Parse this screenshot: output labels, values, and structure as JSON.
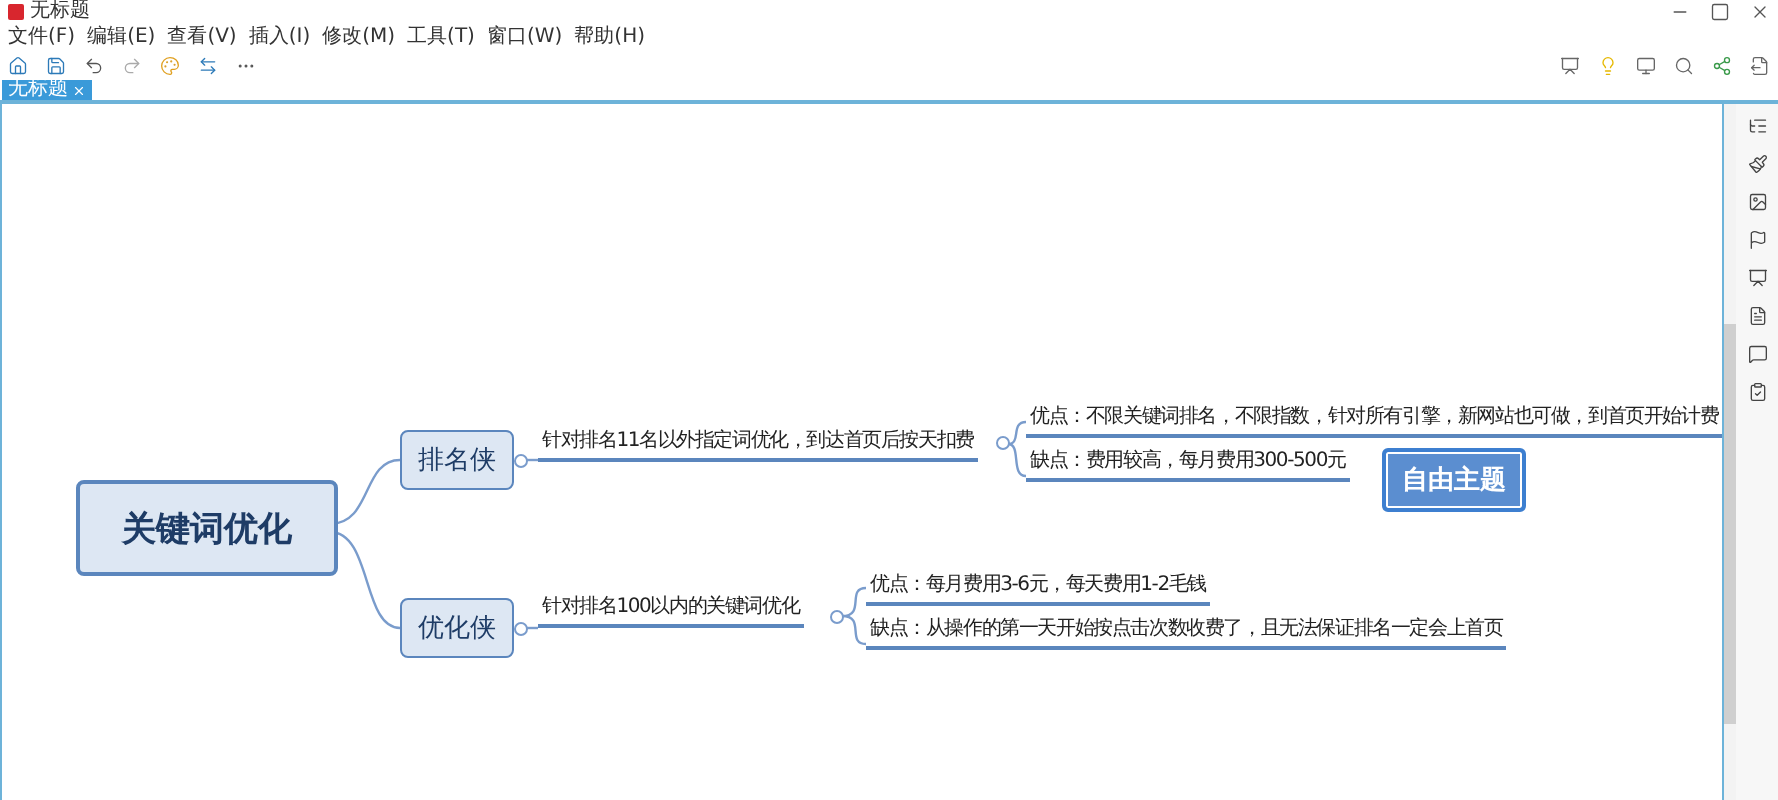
{
  "window": {
    "title": "无标题"
  },
  "menu": [
    "文件(F)",
    "编辑(E)",
    "查看(V)",
    "插入(I)",
    "修改(M)",
    "工具(T)",
    "窗口(W)",
    "帮助(H)"
  ],
  "tabs": [
    {
      "label": "无标题",
      "selected": true
    }
  ],
  "map": {
    "central": {
      "text": "关键词优化",
      "children": [
        {
          "text": "排名侠",
          "children": [
            {
              "text": "针对排名11名以外指定词优化，到达首页后按天扣费",
              "children": [
                {
                  "text": "优点：不限关键词排名，不限指数，针对所有引擎，新网站也可做，到首页开始计费"
                },
                {
                  "text": "缺点：费用较高，每月费用300-500元"
                }
              ]
            }
          ]
        },
        {
          "text": "优化侠",
          "children": [
            {
              "text": "针对排名100以内的关键词优化",
              "children": [
                {
                  "text": "优点：每月费用3-6元，每天费用1-2毛钱"
                },
                {
                  "text": "缺点：从操作的第一天开始按点击次数收费了，且无法保证排名一定会上首页"
                }
              ]
            }
          ]
        }
      ]
    },
    "floating": {
      "text": "自由主题",
      "selected": true
    }
  }
}
